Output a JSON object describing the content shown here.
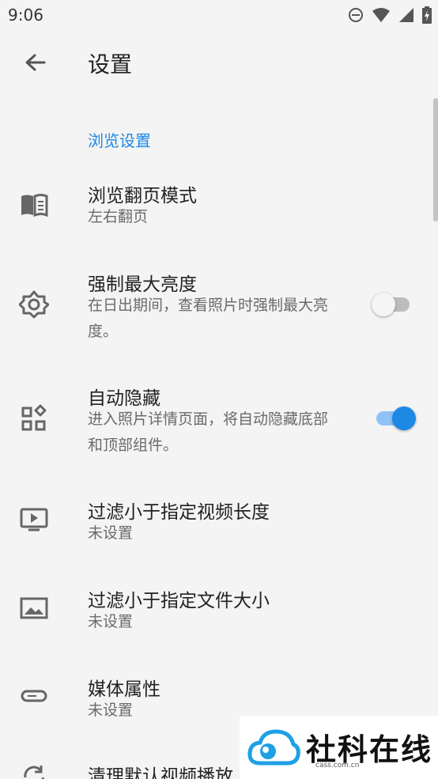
{
  "status_bar": {
    "time": "9:06",
    "icons": [
      "do-not-disturb-icon",
      "wifi-icon",
      "signal-icon",
      "battery-charging-icon"
    ]
  },
  "toolbar": {
    "back_icon": "arrow-left-icon",
    "title": "设置"
  },
  "section": {
    "title": "浏览设置"
  },
  "settings": [
    {
      "icon": "book-icon",
      "title": "浏览翻页模式",
      "subtitle": "左右翻页"
    },
    {
      "icon": "brightness-icon",
      "title": "强制最大亮度",
      "subtitle": "在日出期间，查看照片时强制最大亮度。",
      "switch": "off"
    },
    {
      "icon": "widgets-icon",
      "title": "自动隐藏",
      "subtitle": "进入照片详情页面，将自动隐藏底部和顶部组件。",
      "switch": "on"
    },
    {
      "icon": "video-icon",
      "title": "过滤小于指定视频长度",
      "subtitle": "未设置"
    },
    {
      "icon": "image-icon",
      "title": "过滤小于指定文件大小",
      "subtitle": "未设置"
    },
    {
      "icon": "tag-icon",
      "title": "媒体属性",
      "subtitle": "未设置"
    },
    {
      "icon": "sync-icon",
      "title": "清理默认视频播放"
    }
  ],
  "watermark": {
    "text": "社科在线",
    "url": "cass.com.cn"
  },
  "colors": {
    "accent": "#1e88e5",
    "background": "#f4f4f4"
  }
}
